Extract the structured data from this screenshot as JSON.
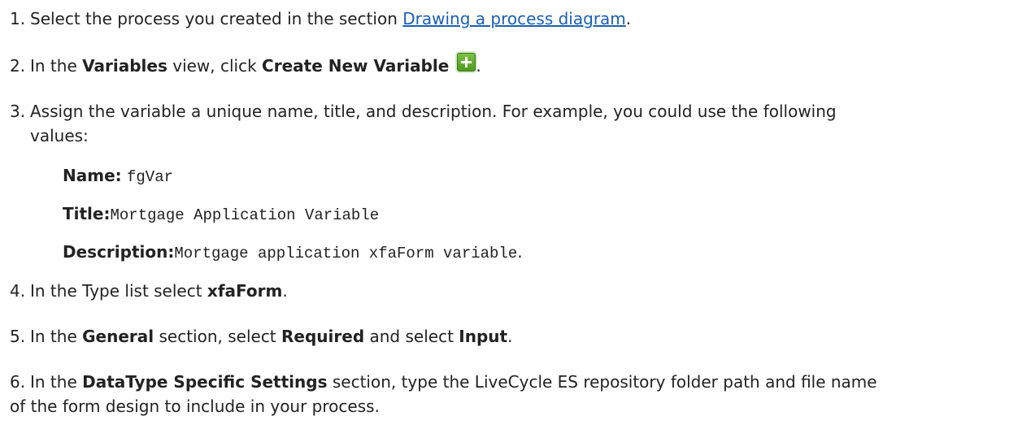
{
  "steps": {
    "s1": {
      "num": "1.",
      "pre": "Select the process you created in the section ",
      "link": "Drawing a process diagram",
      "post": "."
    },
    "s2": {
      "num": "2.",
      "pre": "In the ",
      "b1": "Variables",
      "mid": " view, click ",
      "b2": "Create New Variable",
      "icon": "add-variable-icon",
      "post": "."
    },
    "s3": {
      "num": "3.",
      "line1": "Assign the variable a unique name, title, and description. For example, you could use the following",
      "line2": "values:",
      "examples": {
        "name_label": "Name:",
        "name_value": "fgVar",
        "title_label": "Title:",
        "title_value": "Mortgage Application Variable",
        "desc_label": "Description:",
        "desc_value": "Mortgage application xfaForm variable",
        "desc_post": "."
      }
    },
    "s4": {
      "num": "4.",
      "pre": "In the Type list select ",
      "b1": "xfaForm",
      "post": "."
    },
    "s5": {
      "num": "5.",
      "pre": "In the ",
      "b1": "General",
      "mid1": " section, select ",
      "b2": "Required",
      "mid2": " and select ",
      "b3": "Input",
      "post": "."
    },
    "s6": {
      "num": "6.",
      "pre": "In the ",
      "b1": "DataType Specific Settings",
      "post": " section, type the LiveCycle ES repository folder path and file name",
      "line2": "of the form design to include in your process."
    }
  },
  "colors": {
    "text": "#222222",
    "link": "#1a5fb4",
    "icon_green": "#5aa82a"
  }
}
